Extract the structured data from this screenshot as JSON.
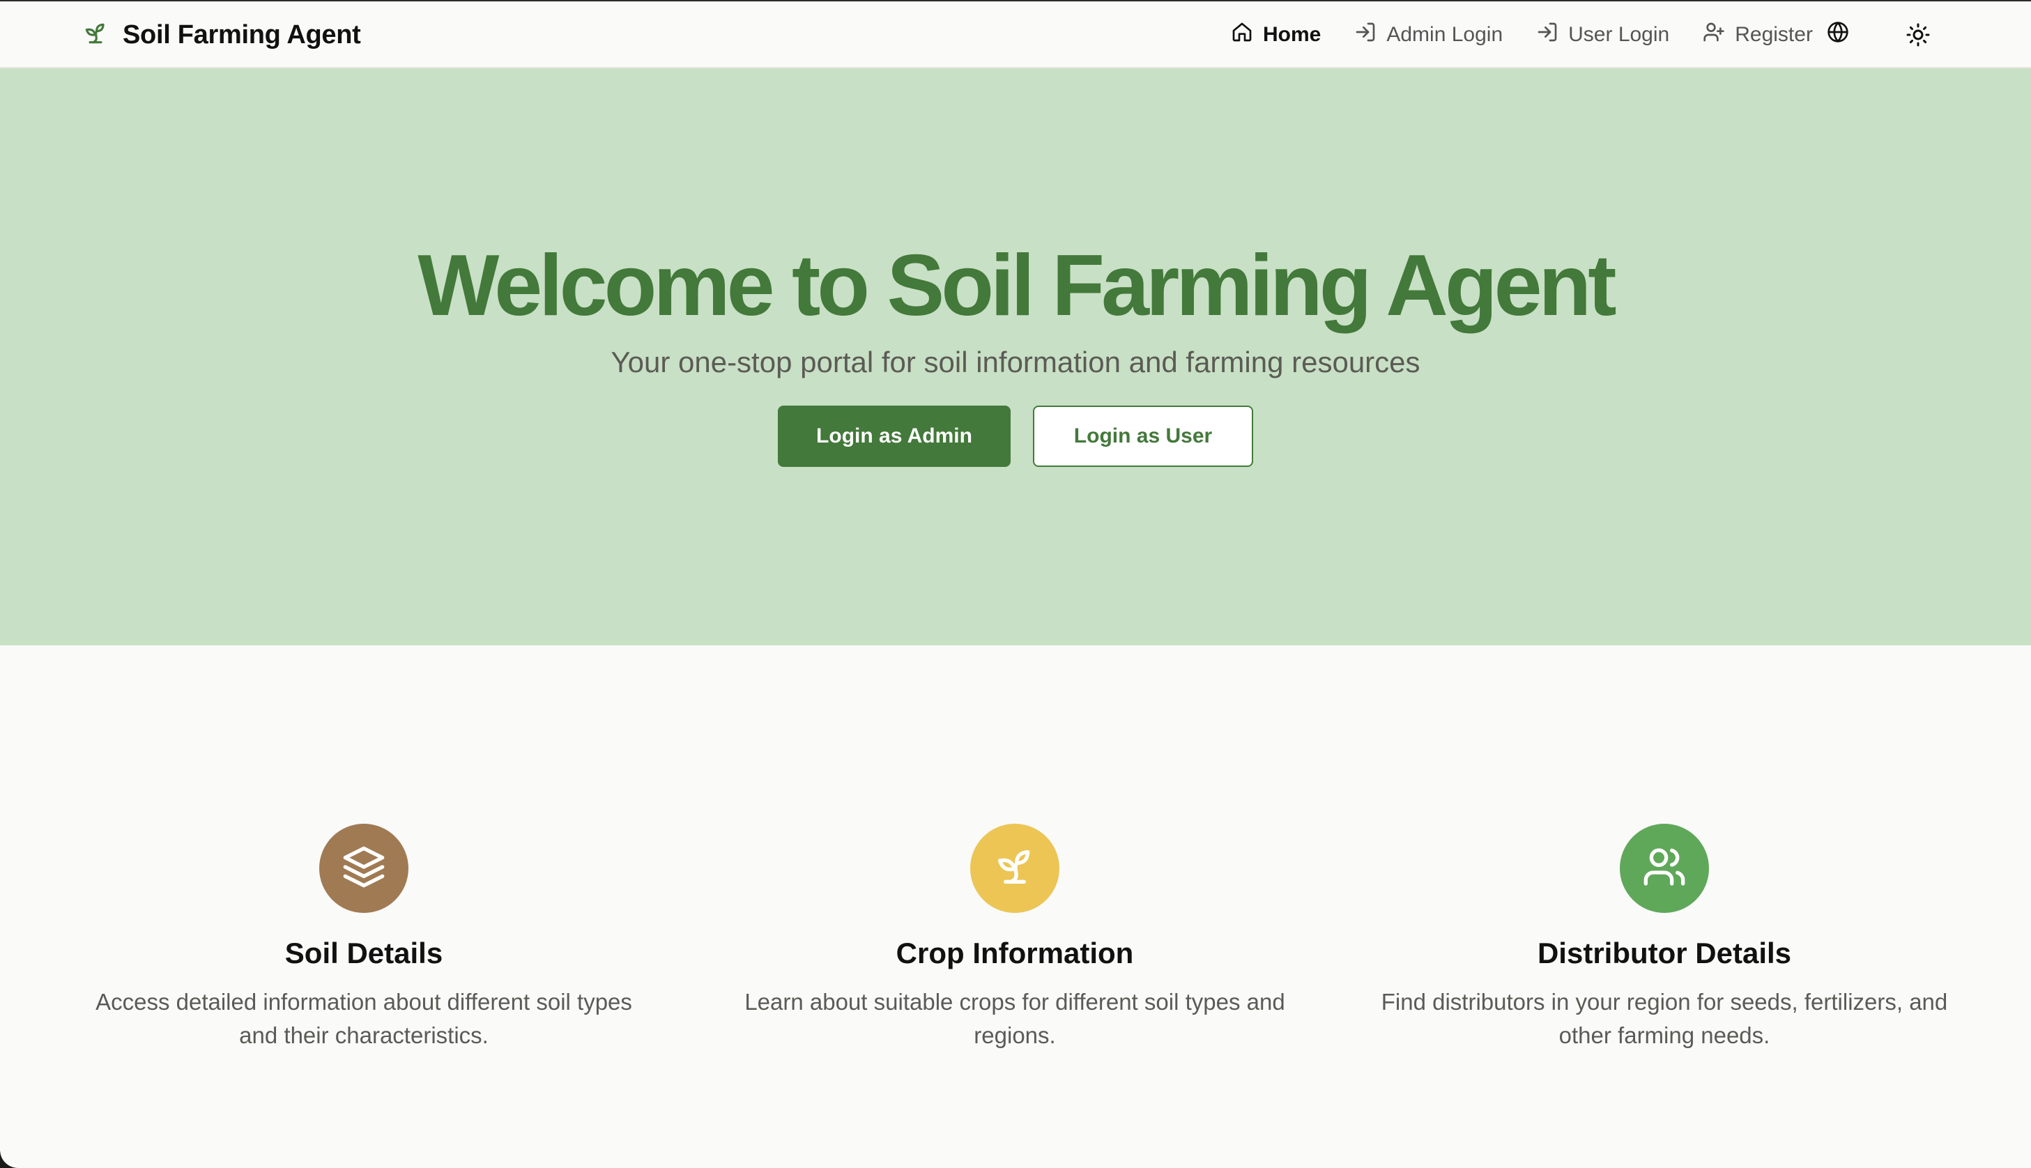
{
  "navbar": {
    "brand": "Soil Farming Agent",
    "links": [
      {
        "label": "Home",
        "icon": "home-icon",
        "active": true
      },
      {
        "label": "Admin Login",
        "icon": "login-icon",
        "active": false
      },
      {
        "label": "User Login",
        "icon": "login-icon",
        "active": false
      },
      {
        "label": "Register",
        "icon": "user-plus-icon",
        "active": false
      }
    ],
    "language_icon": "globe-icon",
    "theme_icon": "sun-icon"
  },
  "hero": {
    "title": "Welcome to Soil Farming Agent",
    "subtitle": "Your one-stop portal for soil information and farming resources",
    "primary_button": "Login as Admin",
    "secondary_button": "Login as User"
  },
  "features": [
    {
      "title": "Soil Details",
      "description": "Access detailed information about different soil types and their characteristics.",
      "icon": "layers-icon",
      "color": "#a07a53"
    },
    {
      "title": "Crop Information",
      "description": "Learn about suitable crops for different soil types and regions.",
      "icon": "sprout-icon",
      "color": "#ecc555"
    },
    {
      "title": "Distributor Details",
      "description": "Find distributors in your region for seeds, fertilizers, and other farming needs.",
      "icon": "users-icon",
      "color": "#5fa85a"
    }
  ],
  "colors": {
    "brand_green": "#43793a",
    "hero_background": "#c8e0c5",
    "page_background": "#fafaf9"
  }
}
